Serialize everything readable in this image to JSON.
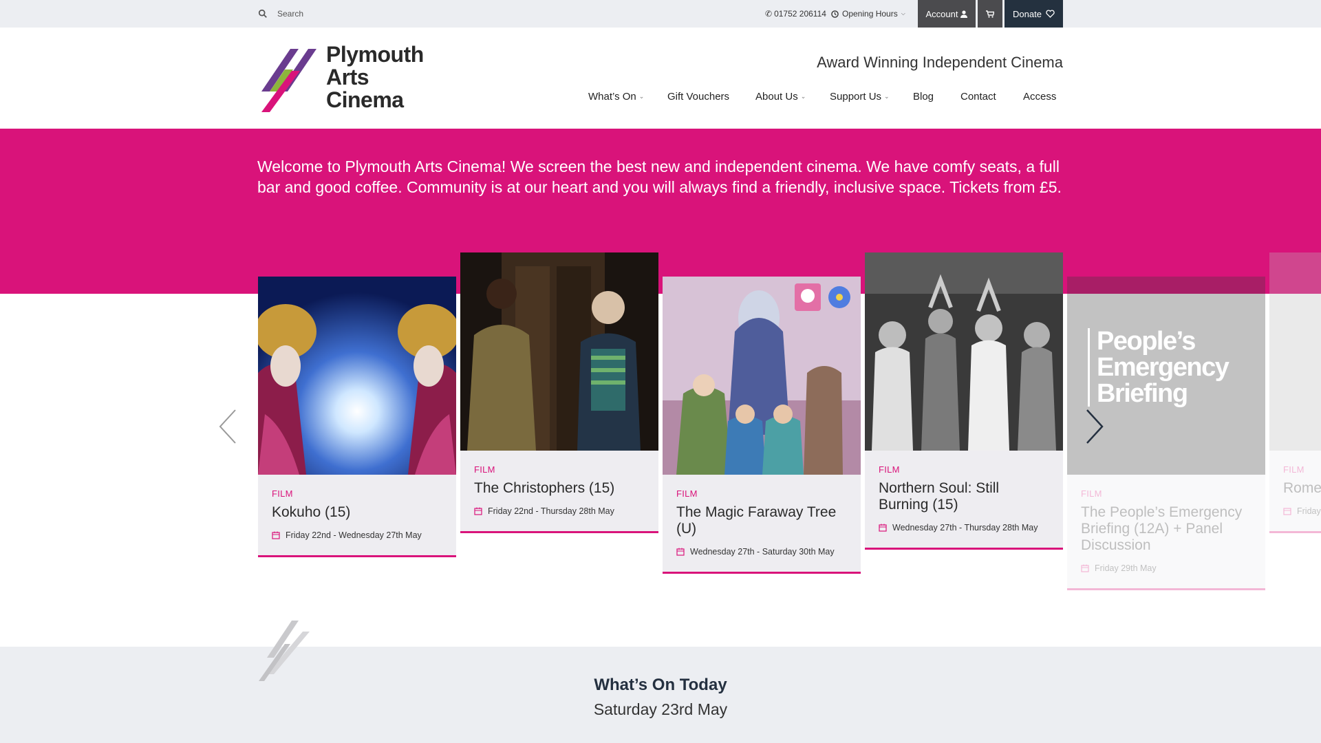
{
  "topbar": {
    "search_placeholder": "Search",
    "phone": "01752 206114",
    "opening_hours": "Opening Hours",
    "account_label": "Account",
    "donate_label": "Donate"
  },
  "brand": {
    "name_line1": "Plymouth",
    "name_line2": "Arts",
    "name_line3": "Cinema",
    "tagline": "Award Winning Independent Cinema",
    "colors": {
      "pink": "#d9137a",
      "purple": "#6a3c8f",
      "green": "#8db53c",
      "navy": "#24313f"
    }
  },
  "nav": {
    "items": [
      {
        "label": "What’s On",
        "dropdown": true
      },
      {
        "label": "Gift Vouchers",
        "dropdown": false
      },
      {
        "label": "About Us",
        "dropdown": true
      },
      {
        "label": "Support Us",
        "dropdown": true
      },
      {
        "label": "Blog",
        "dropdown": false
      },
      {
        "label": "Contact",
        "dropdown": false
      },
      {
        "label": "Access",
        "dropdown": false
      }
    ]
  },
  "hero": {
    "text": "Welcome to Plymouth Arts Cinema! We screen the best new and independent cinema. We have comfy seats, a full bar and good coffee. Community is at our heart and you will always find a friendly, inclusive space. Tickets from £5."
  },
  "carousel": {
    "cards": [
      {
        "category": "FILM",
        "title": "Kokuho (15)",
        "dates": "Friday 22nd - Wednesday 27th May"
      },
      {
        "category": "FILM",
        "title": "The Christophers (15)",
        "dates": "Friday 22nd - Thursday 28th May"
      },
      {
        "category": "FILM",
        "title": "The Magic Faraway Tree (U)",
        "dates": "Wednesday 27th - Saturday 30th May"
      },
      {
        "category": "FILM",
        "title": "Northern Soul: Still Burning (15)",
        "dates": "Wednesday 27th - Thursday 28th May"
      },
      {
        "category": "FILM",
        "title": "The People’s Emergency Briefing (12A) + Panel Discussion",
        "dates": "Friday 29th May",
        "poster_text": "People’s Emergency Briefing"
      },
      {
        "category": "FILM",
        "title": "Rome",
        "dates": "Friday"
      }
    ]
  },
  "whats_on_today": {
    "heading": "What’s On Today",
    "date": "Saturday 23rd May"
  }
}
